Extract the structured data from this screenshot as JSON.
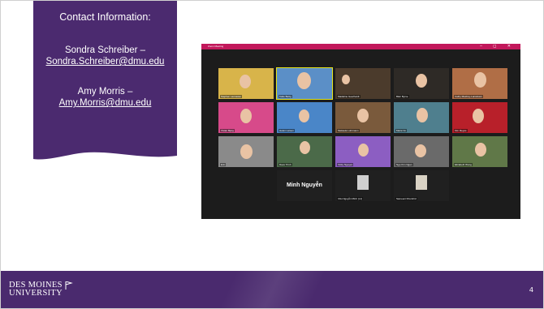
{
  "contact": {
    "title": "Contact Information:",
    "person1_name": "Sondra Schreiber –",
    "person1_email": "Sondra.Schreiber@dmu.edu",
    "person2_name": "Amy Morris –",
    "person2_email": "Amy.Morris@dmu.edu"
  },
  "zoom": {
    "window_title": "Zoom Meeting",
    "controls": "– ◻ ✕",
    "tiles": [
      {
        "label": "Stephen Lancaster",
        "bg": "#d8b44a"
      },
      {
        "label": "Katie Bettg",
        "bg": "#5b8fc7"
      },
      {
        "label": "Madeline Geerhardt",
        "bg": "#4b3b2c"
      },
      {
        "label": "Blair Byme",
        "bg": "#2e2a26"
      },
      {
        "label": "Cathy Mashey-Lansdown",
        "bg": "#b06e46"
      },
      {
        "label": "Vivian Bjorg",
        "bg": "#d74a8a"
      },
      {
        "label": "Helen Larsen",
        "bg": "#4a86c8"
      },
      {
        "label": "Mekaela Lohrmann",
        "bg": "#7a5a3c"
      },
      {
        "label": "Maria Vu",
        "bg": "#4f7f8e"
      },
      {
        "label": "Kim Reyes",
        "bg": "#b8202a"
      },
      {
        "label": "Erin",
        "bg": "#8a8a8a"
      },
      {
        "label": "Dave Trinh",
        "bg": "#4b6a49"
      },
      {
        "label": "Vicky Nguyen",
        "bg": "#8c5ec2"
      },
      {
        "label": "Ngo Kim Ngan",
        "bg": "#6a6a6a"
      },
      {
        "label": "Elizabeth Wong",
        "bg": "#607848"
      }
    ],
    "minh_label": "Minh Nguyễn",
    "cau_label": "Cầu Nguyễn Minh (L1)",
    "sameeni_label": "Sameeni Khurshid"
  },
  "footer": {
    "logo_line1": "DES MOINES",
    "logo_line2": "UNIVERSITY",
    "page_number": "4"
  }
}
